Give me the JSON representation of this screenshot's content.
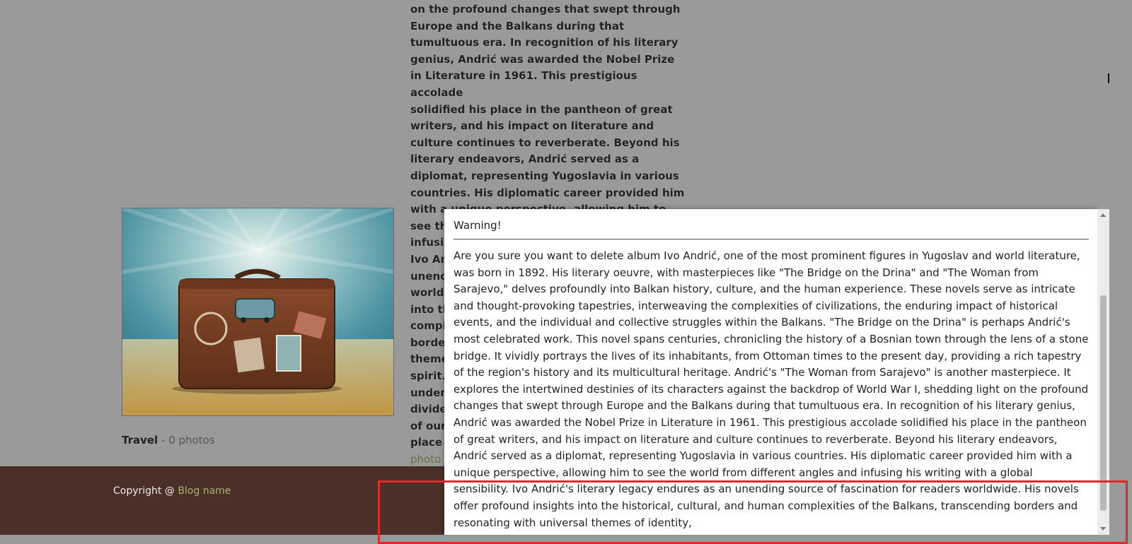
{
  "background_article": {
    "lines": [
      "on the profound changes that swept through",
      "Europe and the Balkans during that",
      "tumultuous era. In recognition of his literary",
      "genius, Andrić was awarded the Nobel Prize",
      "in Literature in 1961. This prestigious accolade",
      "solidified his place in the pantheon of great",
      "writers, and his impact on literature and",
      "culture continues to reverberate. Beyond his",
      "literary endeavors, Andrić served as a",
      "diplomat, representing Yugoslavia in various",
      "countries. His diplomatic career provided him",
      "with a unique perspective, allowing him to",
      "see the world from different angles and",
      "infusi",
      "Ivo An",
      "unend",
      "world",
      "into th",
      "compl",
      "borde",
      "theme",
      "spirit.",
      "under",
      "divide",
      "of our",
      "place"
    ],
    "photos_link": "photo"
  },
  "album": {
    "category": "Travel",
    "count_text": " - 0 photos"
  },
  "footer": {
    "copyright_text": "Copyright @ ",
    "blog_name_link": "Blog name"
  },
  "modal": {
    "title": "Warning!",
    "body": "Are you sure you want to delete album Ivo Andrić, one of the most prominent figures in Yugoslav and world literature, was born in 1892. His literary oeuvre, with masterpieces like \"The Bridge on the Drina\" and \"The Woman from Sarajevo,\" delves profoundly into Balkan history, culture, and the human experience. These novels serve as intricate and thought-provoking tapestries, interweaving the complexities of civilizations, the enduring impact of historical events, and the individual and collective struggles within the Balkans. \"The Bridge on the Drina\" is perhaps Andrić's most celebrated work. This novel spans centuries, chronicling the history of a Bosnian town through the lens of a stone bridge. It vividly portrays the lives of its inhabitants, from Ottoman times to the present day, providing a rich tapestry of the region's history and its multicultural heritage. Andrić's \"The Woman from Sarajevo\" is another masterpiece. It explores the intertwined destinies of its characters against the backdrop of World War I, shedding light on the profound changes that swept through Europe and the Balkans during that tumultuous era. In recognition of his literary genius, Andrić was awarded the Nobel Prize in Literature in 1961. This prestigious accolade solidified his place in the pantheon of great writers, and his impact on literature and culture continues to reverberate. Beyond his literary endeavors, Andrić served as a diplomat, representing Yugoslavia in various countries. His diplomatic career provided him with a unique perspective, allowing him to see the world from different angles and infusing his writing with a global sensibility. Ivo Andrić's literary legacy endures as an unending source of fascination for readers worldwide. His novels offer profound insights into the historical, cultural, and human complexities of the Balkans, transcending borders and resonating with universal themes of identity,"
  },
  "colors": {
    "overlay_background": "#9a9a9a",
    "footer_background": "#4a3029",
    "link_green": "#a9b36a",
    "highlight_red": "#e3282c"
  },
  "icons": {
    "album_image": "suitcase-travel-image"
  }
}
